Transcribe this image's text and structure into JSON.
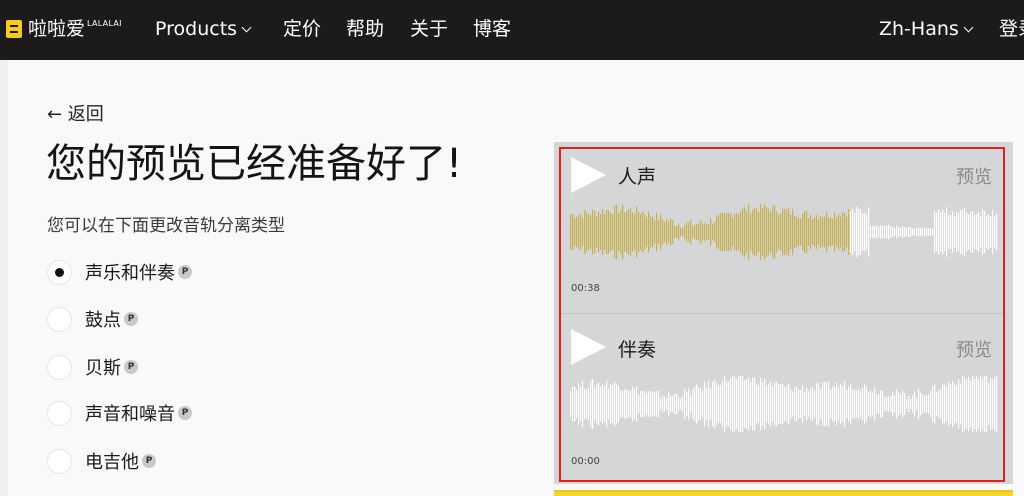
{
  "nav": {
    "logo_text": "啦啦爱",
    "logo_sup": "LALALAI",
    "products": "Products",
    "pricing": "定价",
    "help": "帮助",
    "about": "关于",
    "blog": "博客",
    "language": "Zh-Hans",
    "login": "登录"
  },
  "page": {
    "back": "← 返回",
    "title": "您的预览已经准备好了!",
    "subtitle": "您可以在下面更改音轨分离类型"
  },
  "options": [
    {
      "label": "声乐和伴奏",
      "selected": true,
      "badge": "P"
    },
    {
      "label": "鼓点",
      "selected": false,
      "badge": "P"
    },
    {
      "label": "贝斯",
      "selected": false,
      "badge": "P"
    },
    {
      "label": "声音和噪音",
      "selected": false,
      "badge": "P"
    },
    {
      "label": "电吉他",
      "selected": false,
      "badge": "P"
    }
  ],
  "tracks": [
    {
      "name": "人声",
      "preview": "预览",
      "time": "00:38",
      "progress": 0.65
    },
    {
      "name": "伴奏",
      "preview": "预览",
      "time": "00:00",
      "progress": 0
    }
  ],
  "colors": {
    "played": "#c9b04e",
    "unplayed": "#ffffff",
    "logo": "#f7cb1c",
    "highlight": "#e02020"
  }
}
